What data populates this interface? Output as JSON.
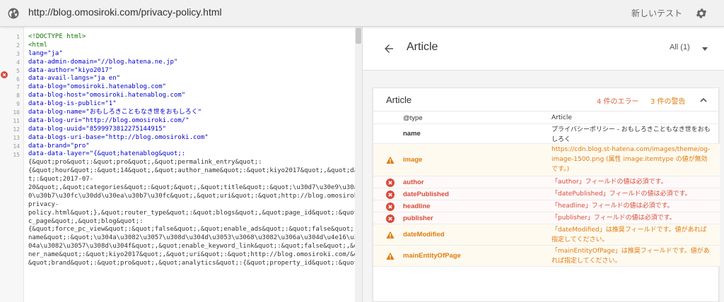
{
  "toolbar": {
    "url": "http://blog.omosiroki.com/privacy-policy.html",
    "new_test_label": "新しいテスト",
    "globe_icon": "globe-icon",
    "settings_icon": "gear-icon"
  },
  "editor": {
    "line_numbers": [
      "1",
      "2",
      "3",
      "4",
      "5",
      "6",
      "7",
      "8",
      "9",
      "10",
      "11",
      "12",
      "13",
      "14",
      "15"
    ],
    "lines": [
      "<!DOCTYPE html>",
      "<html",
      "  lang=\"ja\"",
      "data-admin-domain=\"//blog.hatena.ne.jp\"",
      "data-author=\"kiyo2017\"",
      "data-avail-langs=\"ja en\"",
      "data-blog=\"omosiroki.hatenablog.com\"",
      "data-blog-host=\"omosiroki.hatenablog.com\"",
      "data-blog-is-public=\"1\"",
      "data-blog-name=\"おもしろきこともなき世をおもしろく\"",
      "data-blog-uri=\"http://blog.omosiroki.com/\"",
      "data-blog-uuid=\"8599973812275144915\"",
      "data-blogs-uri-base=\"http://blog.omosiroki.com\"",
      "data-brand=\"pro\"",
      "data-data-layer=\"{&quot;hatenablog&quot;:",
      "{&quot;pro&quot;:&quot;pro&quot;,&quot;permalink_entry&quot;:",
      "{&quot;hour&quot;:&quot;14&quot;,&quot;author_name&quot;:&quot;kiyo2017&quot;,&quot;date&quo",
      "t;:&quot;2017-07-",
      "20&quot;,&quot;categories&quot;:&quot;&quot;,&quot;title&quot;:&quot;\\u30d7\\u30e9\\u30a4\\u30d",
      "0\\u30b7\\u30fc\\u30dd\\u30ea\\u30b7\\u30fc&quot;,&quot;uri&quot;:&quot;http://blog.omosiroki.com/",
      "privacy-",
      "policy.html&quot;},&quot;router_type&quot;:&quot;blogs&quot;,&quot;page_id&quot;:&quot;stati",
      "c_page&quot;,&quot;blog&quot;:",
      "{&quot;force_pc_view&quot;:&quot;false&quot;,&quot;enable_ads&quot;:&quot;false&quot;,&quot;",
      "name&quot;:&quot;\\u304a\\u3082\\u3057\\u308d\\u304d\\u3053\\u3068\\u3082\\u306a\\u304d\\u4e16\\u3092\\u3",
      "04a\\u3082\\u3057\\u308d\\u304f&quot;,&quot;enable_keyword_link&quot;:&quot;false&quot;,&quot;ow",
      "ner_name&quot;:&quot;kiyo2017&quot;,&quot;uri&quot;:&quot;http://blog.omosiroki.com/&quot;},",
      "&quot;brand&quot;:&quot;pro&quot;,&quot;analytics&quot;:{&quot;property_id&quot;:&quot;UA-"
    ]
  },
  "panel": {
    "title": "Article",
    "filter_label": "All (1)",
    "card": {
      "title": "Article",
      "error_count": "4 件のエラー",
      "warning_count": "3 件の警告",
      "rows": [
        {
          "name": "@type",
          "value": "Article",
          "status": "none"
        },
        {
          "name": "name",
          "value": "プライバシーポリシー - おもしろきこともなき世をおもしろく",
          "status": "none"
        },
        {
          "name": "image",
          "value": "https://cdn.blog.st-hatena.com/images/theme/og-image-1500.png (属性 image.itemtype の値が無効です。)",
          "status": "warning"
        },
        {
          "name": "author",
          "value": "「author」フィールドの値は必須です。",
          "status": "error"
        },
        {
          "name": "datePublished",
          "value": "「datePublished」フィールドの値は必須です。",
          "status": "error"
        },
        {
          "name": "headline",
          "value": "「headline」フィールドの値は必須です。",
          "status": "error"
        },
        {
          "name": "publisher",
          "value": "「publisher」フィールドの値は必須です。",
          "status": "error"
        },
        {
          "name": "dateModified",
          "value": "「dateModified」は推奨フィールドです。値があれば指定してください。",
          "status": "warning"
        },
        {
          "name": "mainEntityOfPage",
          "value": "「mainEntityOfPage」は推奨フィールドです。値があれば指定してください。",
          "status": "warning"
        }
      ]
    }
  },
  "colors": {
    "error": "#d84a3a",
    "warning": "#e07c10"
  }
}
